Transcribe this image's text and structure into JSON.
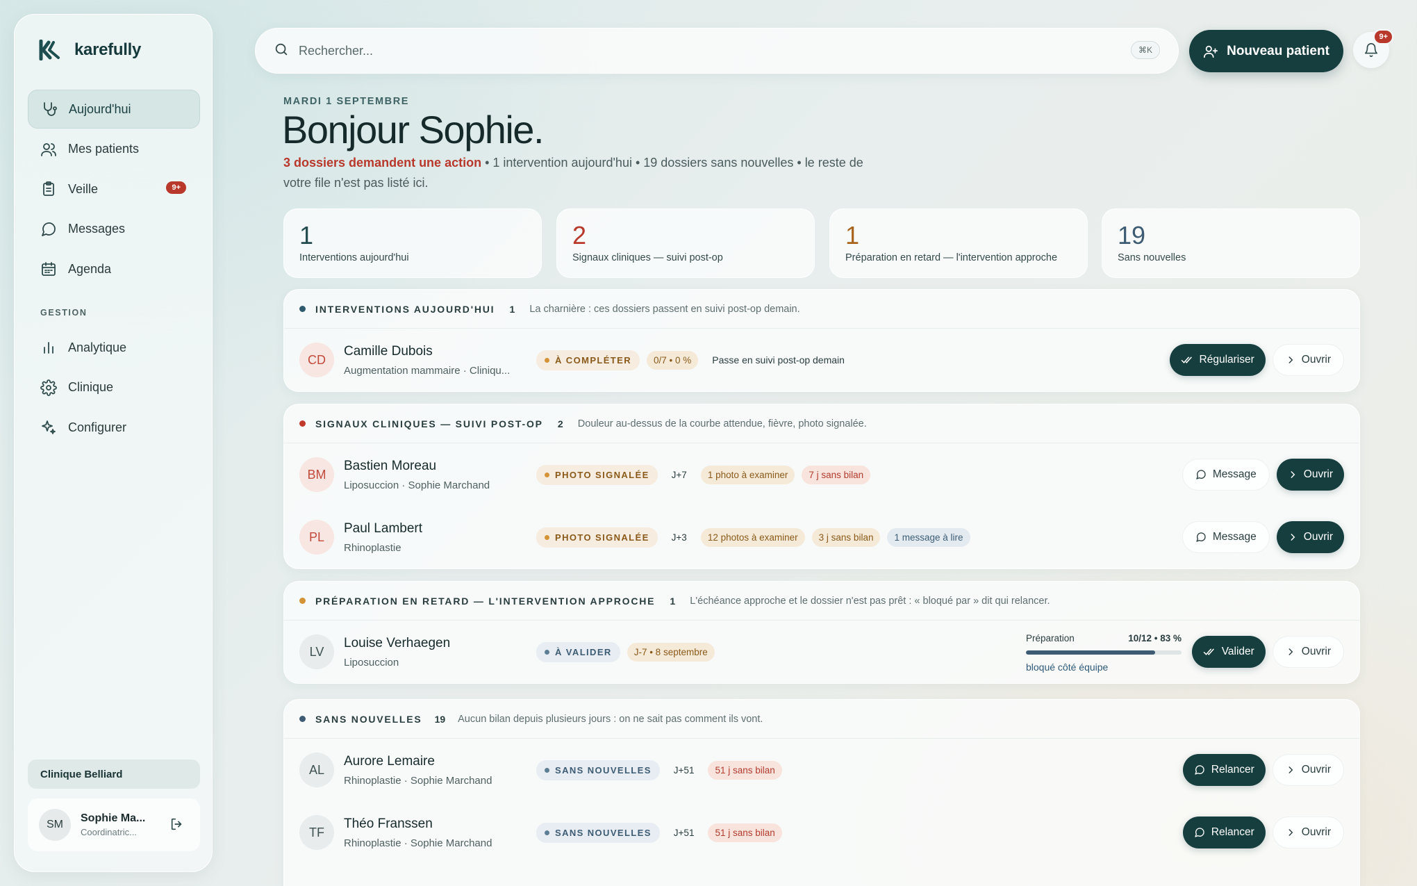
{
  "brand": {
    "name": "karefully"
  },
  "sidebar": {
    "nav": [
      {
        "label": "Aujourd'hui",
        "icon": "stethoscope-icon",
        "active": true
      },
      {
        "label": "Mes patients",
        "icon": "users-icon"
      },
      {
        "label": "Veille",
        "icon": "clipboard-icon",
        "badge": "9+"
      },
      {
        "label": "Messages",
        "icon": "message-icon"
      },
      {
        "label": "Agenda",
        "icon": "calendar-icon"
      }
    ],
    "section_label": "GESTION",
    "gestion": [
      {
        "label": "Analytique",
        "icon": "bar-chart-icon"
      },
      {
        "label": "Clinique",
        "icon": "gear-icon"
      },
      {
        "label": "Configurer",
        "icon": "sparkle-icon"
      }
    ],
    "clinic": "Clinique Belliard",
    "user": {
      "initials": "SM",
      "name": "Sophie Ma...",
      "role": "Coordinatric..."
    }
  },
  "search": {
    "placeholder": "Rechercher...",
    "shortcut": "⌘K"
  },
  "header": {
    "new_patient": "Nouveau patient",
    "notif_badge": "9+"
  },
  "greeting": {
    "date": "MARDI 1 SEPTEMBRE",
    "title": "Bonjour Sophie.",
    "alert": "3 dossiers demandent une action",
    "rest": " • 1 intervention aujourd'hui • 19 dossiers sans nouvelles • le reste de votre file n'est pas listé ici."
  },
  "stats": [
    {
      "value": "1",
      "label": "Interventions aujourd'hui",
      "color": "#234a4c"
    },
    {
      "value": "2",
      "label": "Signaux cliniques — suivi post-op",
      "color": "#b8382b"
    },
    {
      "value": "1",
      "label": "Préparation en retard — l'intervention approche",
      "color": "#a8641d"
    },
    {
      "value": "19",
      "label": "Sans nouvelles",
      "color": "#3d5c73"
    }
  ],
  "groups": {
    "interventions": {
      "title": "INTERVENTIONS AUJOURD'HUI",
      "count": "1",
      "desc": "La charnière : ces dossiers passent en suivi post-op demain.",
      "dot": "#2f5a6e",
      "rows": [
        {
          "initials": "CD",
          "name": "Camille Dubois",
          "sub": "Augmentation mammaire · Cliniqu...",
          "status": "À COMPLÉTER",
          "chip1": "0/7 • 0 %",
          "note": "Passe en suivi post-op demain",
          "primary": "Régulariser",
          "secondary": "Ouvrir"
        }
      ]
    },
    "signaux": {
      "title": "SIGNAUX CLINIQUES — SUIVI POST-OP",
      "count": "2",
      "desc": "Douleur au-dessus de la courbe attendue, fièvre, photo signalée.",
      "dot": "#c0392b",
      "rows": [
        {
          "initials": "BM",
          "name": "Bastien Moreau",
          "sub": "Liposuccion · Sophie Marchand",
          "status": "PHOTO SIGNALÉE",
          "day": "J+7",
          "chip1": "1 photo à examiner",
          "chip2": "7 j sans bilan",
          "msg": "Message",
          "open": "Ouvrir"
        },
        {
          "initials": "PL",
          "name": "Paul Lambert",
          "sub": "Rhinoplastie",
          "status": "PHOTO SIGNALÉE",
          "day": "J+3",
          "chip1": "12 photos à examiner",
          "chip2": "3 j sans bilan",
          "chip3": "1 message à lire",
          "msg": "Message",
          "open": "Ouvrir"
        }
      ]
    },
    "preparation": {
      "title": "PRÉPARATION EN RETARD — L'INTERVENTION APPROCHE",
      "count": "1",
      "desc": "L'échéance approche et le dossier n'est pas prêt : « bloqué par » dit qui relancer.",
      "dot": "#d59338",
      "rows": [
        {
          "initials": "LV",
          "name": "Louise Verhaegen",
          "sub": "Liposuccion",
          "status": "À VALIDER",
          "chip1": "J-7 • 8 septembre",
          "prep_label": "Préparation",
          "prep_value": "10/12 • 83 %",
          "prep_fraction": 0.83,
          "prep_note": "bloqué côté équipe",
          "primary": "Valider",
          "secondary": "Ouvrir"
        }
      ]
    },
    "sans": {
      "title": "SANS NOUVELLES",
      "count": "19",
      "desc": "Aucun bilan depuis plusieurs jours : on ne sait pas comment ils vont.",
      "dot": "#3d5c73",
      "rows": [
        {
          "initials": "AL",
          "name": "Aurore Lemaire",
          "sub": "Rhinoplastie · Sophie Marchand",
          "status": "SANS NOUVELLES",
          "day": "J+51",
          "chip1": "51 j sans bilan",
          "primary": "Relancer",
          "secondary": "Ouvrir"
        },
        {
          "initials": "TF",
          "name": "Théo Franssen",
          "sub": "Rhinoplastie · Sophie Marchand",
          "status": "SANS NOUVELLES",
          "day": "J+51",
          "chip1": "51 j sans bilan",
          "primary": "Relancer",
          "secondary": "Ouvrir"
        }
      ]
    }
  }
}
